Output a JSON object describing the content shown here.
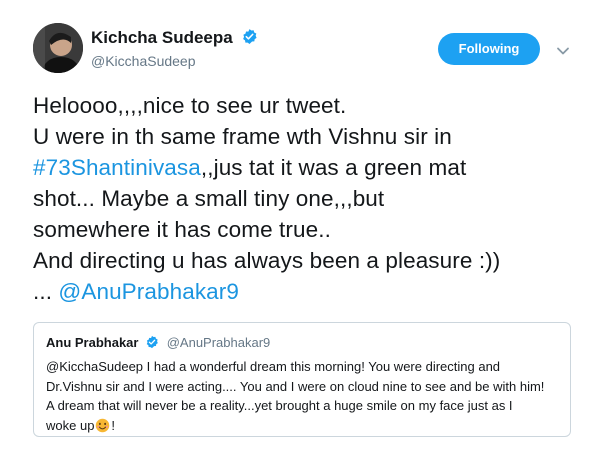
{
  "author": {
    "name": "Kichcha Sudeepa",
    "handle": "@KicchaSudeep",
    "verified": true
  },
  "follow_button": {
    "label": "Following"
  },
  "tweet": {
    "line1": "Heloooo,,,,nice to see ur tweet.",
    "line2": "U were in th same frame wth Vishnu sir in",
    "hashtag": "#73Shantinivasa",
    "line3_rest": ",,jus tat it was a green mat",
    "line4": "shot... Maybe a small tiny one,,,but",
    "line5": "somewhere it has come true..",
    "line6": "And directing u has always been a pleasure :))",
    "line7_prefix": "... ",
    "mention": "@AnuPrabhakar9"
  },
  "quoted_tweet": {
    "name": "Anu Prabhakar",
    "handle": "@AnuPrabhakar9",
    "verified": true,
    "line1": "@KicchaSudeep I had a wonderful dream this morning! You were directing and",
    "line2": "Dr.Vishnu sir and I were acting.... You and I were on cloud nine to see and be with him!",
    "line3": "A dream that will never be a reality...yet brought a huge smile on my face just as I",
    "line4_prefix": "woke up",
    "line4_suffix": "!"
  },
  "icons": {
    "verified": "verified-badge-icon",
    "menu": "chevron-down-icon",
    "emoji": "smiling-face-emoji"
  },
  "colors": {
    "accent": "#1da1f2",
    "link": "#1b95e0",
    "secondary_text": "#657786",
    "border": "#ccd6dd"
  }
}
